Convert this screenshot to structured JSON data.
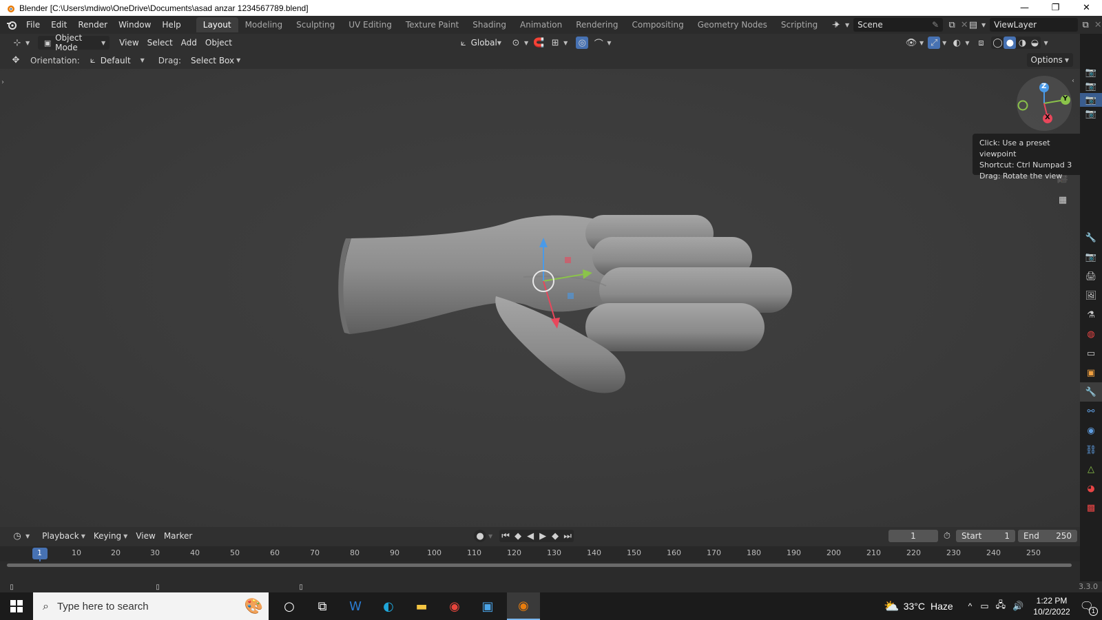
{
  "window": {
    "title": "Blender [C:\\Users\\mdiwo\\OneDrive\\Documents\\asad anzar 1234567789.blend]",
    "controls": [
      "—",
      "❐",
      "✕"
    ]
  },
  "menu": [
    "File",
    "Edit",
    "Render",
    "Window",
    "Help"
  ],
  "workspaces": [
    {
      "label": "Layout",
      "active": true
    },
    {
      "label": "Modeling",
      "active": false
    },
    {
      "label": "Sculpting",
      "active": false
    },
    {
      "label": "UV Editing",
      "active": false
    },
    {
      "label": "Texture Paint",
      "active": false
    },
    {
      "label": "Shading",
      "active": false
    },
    {
      "label": "Animation",
      "active": false
    },
    {
      "label": "Rendering",
      "active": false
    },
    {
      "label": "Compositing",
      "active": false
    },
    {
      "label": "Geometry Nodes",
      "active": false
    },
    {
      "label": "Scripting",
      "active": false
    }
  ],
  "add_workspace": "+",
  "scene": {
    "name": "Scene"
  },
  "view_layer": {
    "name": "ViewLayer"
  },
  "viewport_header": {
    "mode": "Object Mode",
    "menus": [
      "View",
      "Select",
      "Add",
      "Object"
    ],
    "transform_orientation": "Global"
  },
  "tool_settings": {
    "orientation_label": "Orientation:",
    "orientation_value": "Default",
    "drag_label": "Drag:",
    "drag_value": "Select Box",
    "options": "Options"
  },
  "gizmo": {
    "z": "Z",
    "y": "Y",
    "x": "X"
  },
  "tooltip": {
    "line1": "Click: Use a preset viewpoint",
    "line2": "Shortcut: Ctrl Numpad 3",
    "line3": "Drag: Rotate the view"
  },
  "timeline": {
    "menus": [
      "Playback",
      "Keying",
      "View",
      "Marker"
    ],
    "current_frame": "1",
    "start_label": "Start",
    "start_value": "1",
    "end_label": "End",
    "end_value": "250",
    "ruler": [
      "1",
      "10",
      "20",
      "30",
      "40",
      "50",
      "60",
      "70",
      "80",
      "90",
      "100",
      "110",
      "120",
      "130",
      "140",
      "150",
      "160",
      "170",
      "180",
      "190",
      "200",
      "210",
      "220",
      "230",
      "240",
      "250"
    ]
  },
  "status": {
    "version": "3.3.0"
  },
  "taskbar": {
    "search_placeholder": "Type here to search",
    "weather_temp": "33°C",
    "weather_desc": "Haze",
    "time": "1:22 PM",
    "date": "10/2/2022",
    "notification_count": "1"
  },
  "colors": {
    "x_axis": "#e8475b",
    "y_axis": "#8bc34a",
    "z_axis": "#4a9ae8",
    "accent": "#4772b3"
  }
}
